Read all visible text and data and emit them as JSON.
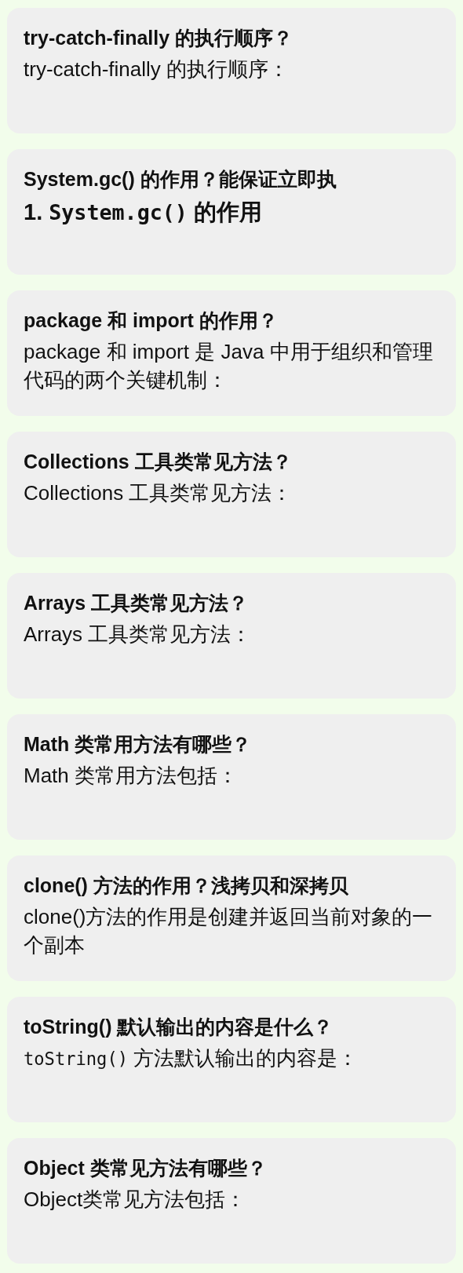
{
  "cards": [
    {
      "title": "try-catch-finally 的执行顺序？",
      "body": {
        "kind": "text",
        "parts": [
          {
            "text": "try-catch-finally 的执行顺序：",
            "mono": false
          }
        ]
      }
    },
    {
      "title": "System.gc() 的作用？能保证立即执",
      "body": {
        "kind": "heading",
        "parts": [
          {
            "text": "1. ",
            "mono": false
          },
          {
            "text": "System.gc()",
            "mono": true
          },
          {
            "text": " 的作用",
            "mono": false
          }
        ]
      }
    },
    {
      "title": "package 和 import 的作用？",
      "body": {
        "kind": "text",
        "parts": [
          {
            "text": "package 和 import 是 Java 中用于组织和管理代码的两个关键机制：",
            "mono": false
          }
        ]
      }
    },
    {
      "title": "Collections 工具类常见方法？",
      "body": {
        "kind": "text",
        "parts": [
          {
            "text": "Collections 工具类常见方法：",
            "mono": false
          }
        ]
      }
    },
    {
      "title": "Arrays 工具类常见方法？",
      "body": {
        "kind": "text",
        "parts": [
          {
            "text": "Arrays 工具类常见方法：",
            "mono": false
          }
        ]
      }
    },
    {
      "title": "Math 类常用方法有哪些？",
      "body": {
        "kind": "text",
        "parts": [
          {
            "text": "Math 类常用方法包括：",
            "mono": false
          }
        ]
      }
    },
    {
      "title": "clone() 方法的作用？浅拷贝和深拷贝",
      "body": {
        "kind": "text",
        "parts": [
          {
            "text": "clone()方法的作用是创建并返回当前对象的一个副本",
            "mono": false
          }
        ]
      }
    },
    {
      "title": "toString() 默认输出的内容是什么？",
      "body": {
        "kind": "text",
        "parts": [
          {
            "text": "toString()",
            "mono": true
          },
          {
            "text": " 方法默认输出的内容是：",
            "mono": false
          }
        ]
      }
    },
    {
      "title": "Object 类常见方法有哪些？",
      "body": {
        "kind": "text",
        "parts": [
          {
            "text": "Object类常见方法包括：",
            "mono": false
          }
        ]
      }
    }
  ]
}
